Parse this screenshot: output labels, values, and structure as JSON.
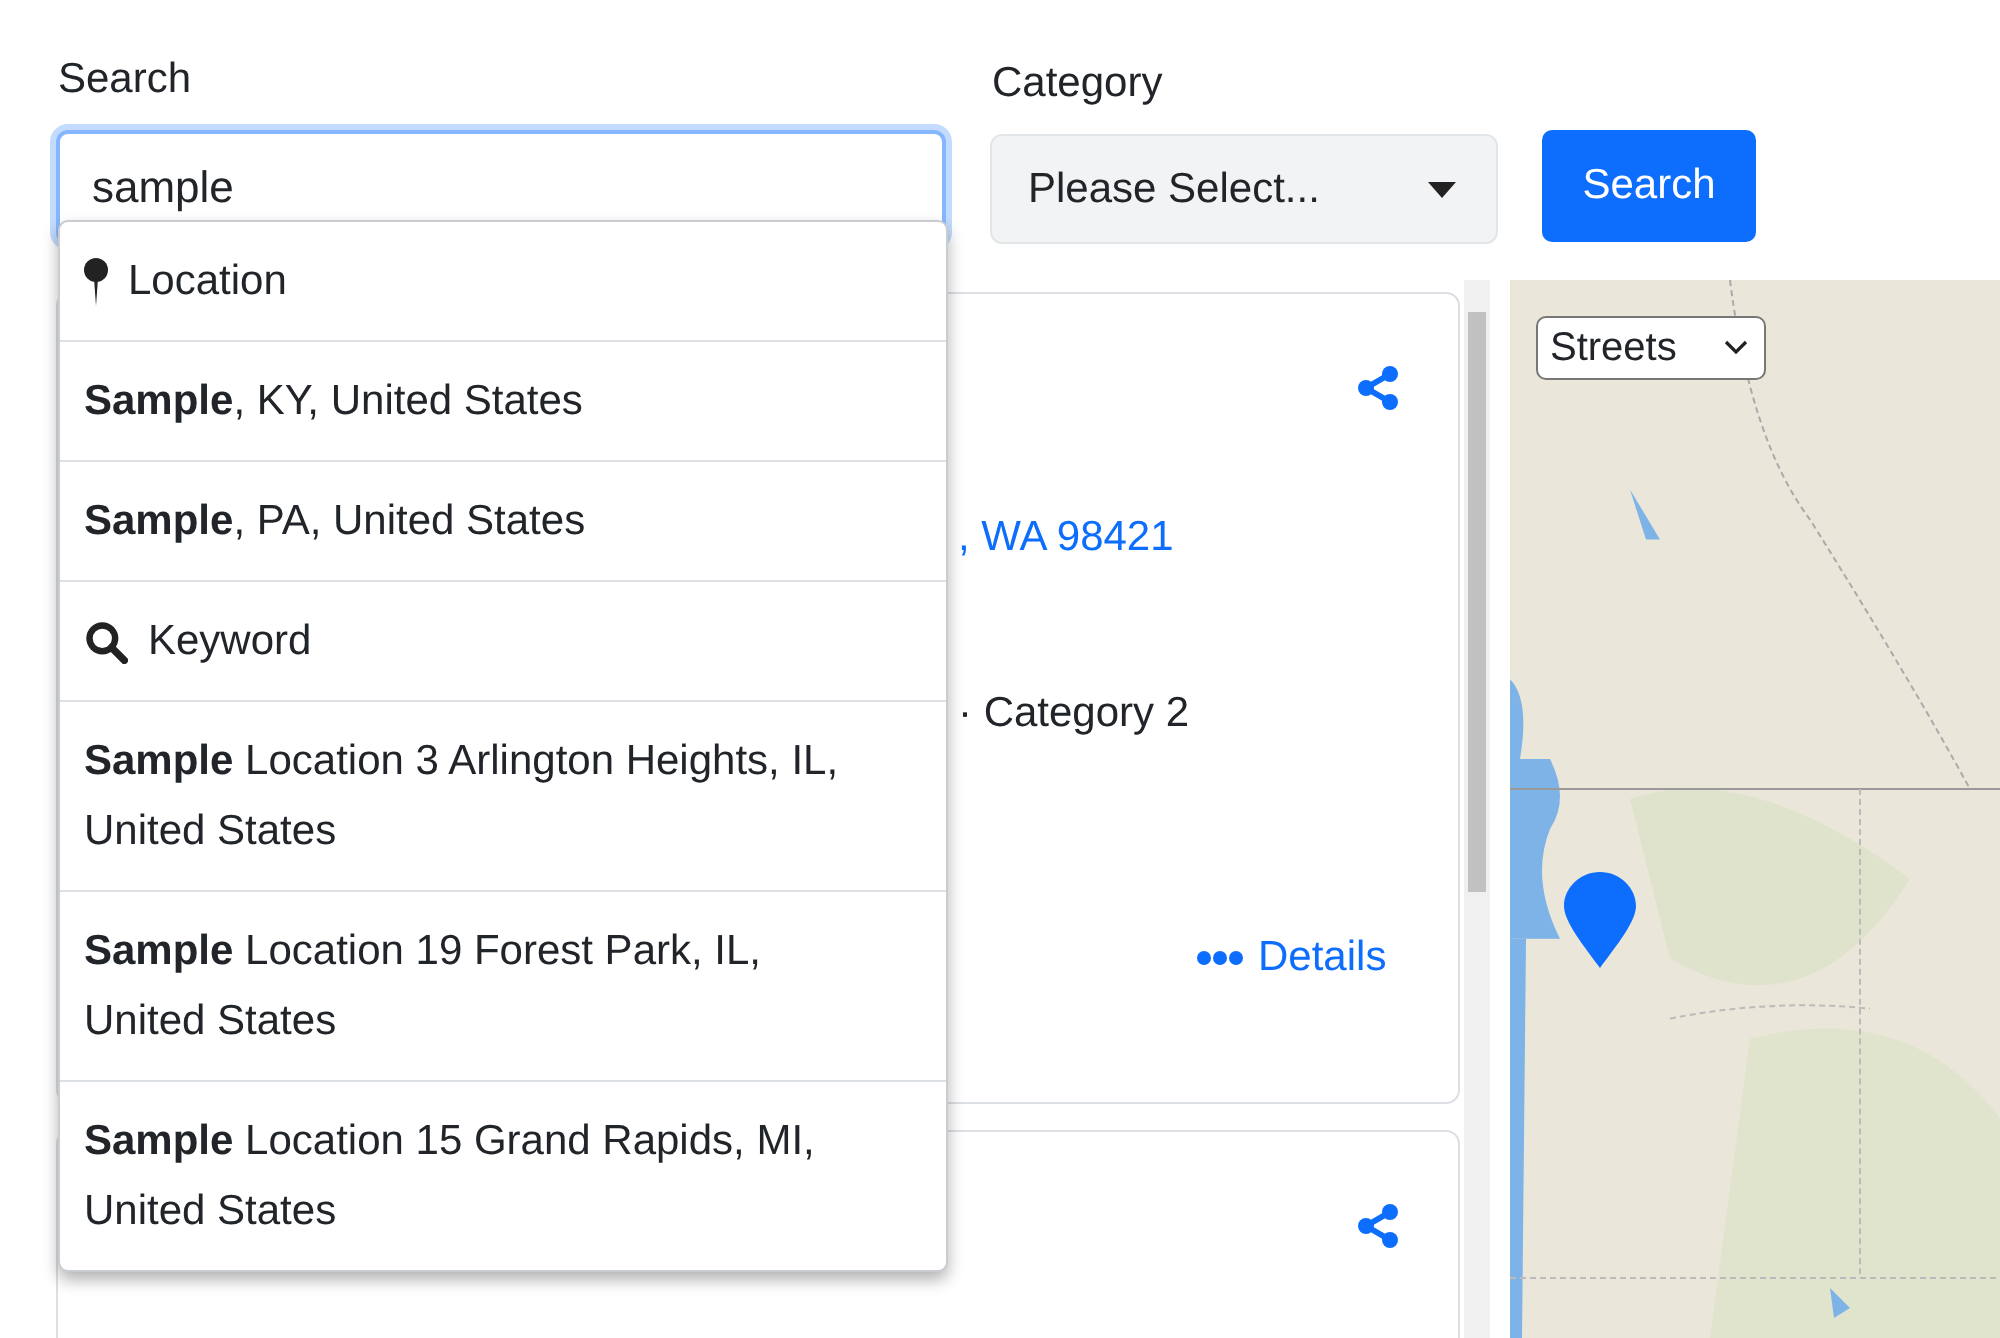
{
  "search": {
    "label": "Search",
    "value": "sample"
  },
  "category": {
    "label": "Category",
    "value": "Please Select..."
  },
  "search_button": "Search",
  "suggestions": [
    {
      "kind": "location",
      "text": "Location"
    },
    {
      "kind": "result",
      "text": "**Sample**, KY, United States"
    },
    {
      "kind": "result",
      "text": "**Sample**, PA, United States"
    },
    {
      "kind": "keyword",
      "text": "Keyword"
    },
    {
      "kind": "result",
      "text": "**Sample** Location 3 Arlington Heights, IL, United States"
    },
    {
      "kind": "result",
      "text": "**Sample** Location 19 Forest Park, IL, United States"
    },
    {
      "kind": "result",
      "text": "**Sample** Location 15 Grand Rapids, MI, United States"
    }
  ],
  "results": [
    {
      "kind": "card",
      "address": ", WA 98421",
      "category": "· Category 2",
      "details": "Details"
    },
    {
      "kind": "card"
    }
  ],
  "map": {
    "layer": "Streets"
  }
}
